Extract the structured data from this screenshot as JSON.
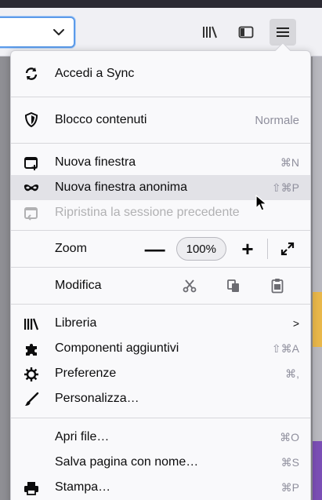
{
  "menu": {
    "sync": {
      "label": "Accedi a Sync",
      "icon": "sync-icon"
    },
    "content_blocking": {
      "label": "Blocco contenuti",
      "value": "Normale",
      "icon": "shield-icon"
    },
    "windows": [
      {
        "label": "Nuova finestra",
        "shortcut": "⌘N",
        "icon": "new-window-icon",
        "state": "normal"
      },
      {
        "label": "Nuova finestra anonima",
        "shortcut": "⇧⌘P",
        "icon": "private-mask-icon",
        "state": "hover"
      },
      {
        "label": "Ripristina la sessione precedente",
        "shortcut": "",
        "icon": "restore-session-icon",
        "state": "disabled"
      }
    ],
    "zoom": {
      "label": "Zoom",
      "minus": "—",
      "level": "100%",
      "plus": "+"
    },
    "edit": {
      "label": "Modifica"
    },
    "tools": [
      {
        "label": "Libreria",
        "shortcut": ">",
        "icon": "library-icon"
      },
      {
        "label": "Componenti aggiuntivi",
        "shortcut": "⇧⌘A",
        "icon": "puzzle-icon"
      },
      {
        "label": "Preferenze",
        "shortcut": "⌘,",
        "icon": "gear-icon"
      },
      {
        "label": "Personalizza…",
        "shortcut": "",
        "icon": "brush-icon"
      }
    ],
    "file": [
      {
        "label": "Apri file…",
        "shortcut": "⌘O",
        "icon": ""
      },
      {
        "label": "Salva pagina con nome…",
        "shortcut": "⌘S",
        "icon": ""
      },
      {
        "label": "Stampa…",
        "shortcut": "⌘P",
        "icon": "printer-icon"
      }
    ]
  },
  "colors": {
    "menu_bg": "#f9f9fb",
    "hover_bg": "#e2e2e7",
    "shortcut_text": "#8f8f9d",
    "disabled_text": "#b1b1b3",
    "urlbar_focus": "#5b9bea"
  }
}
